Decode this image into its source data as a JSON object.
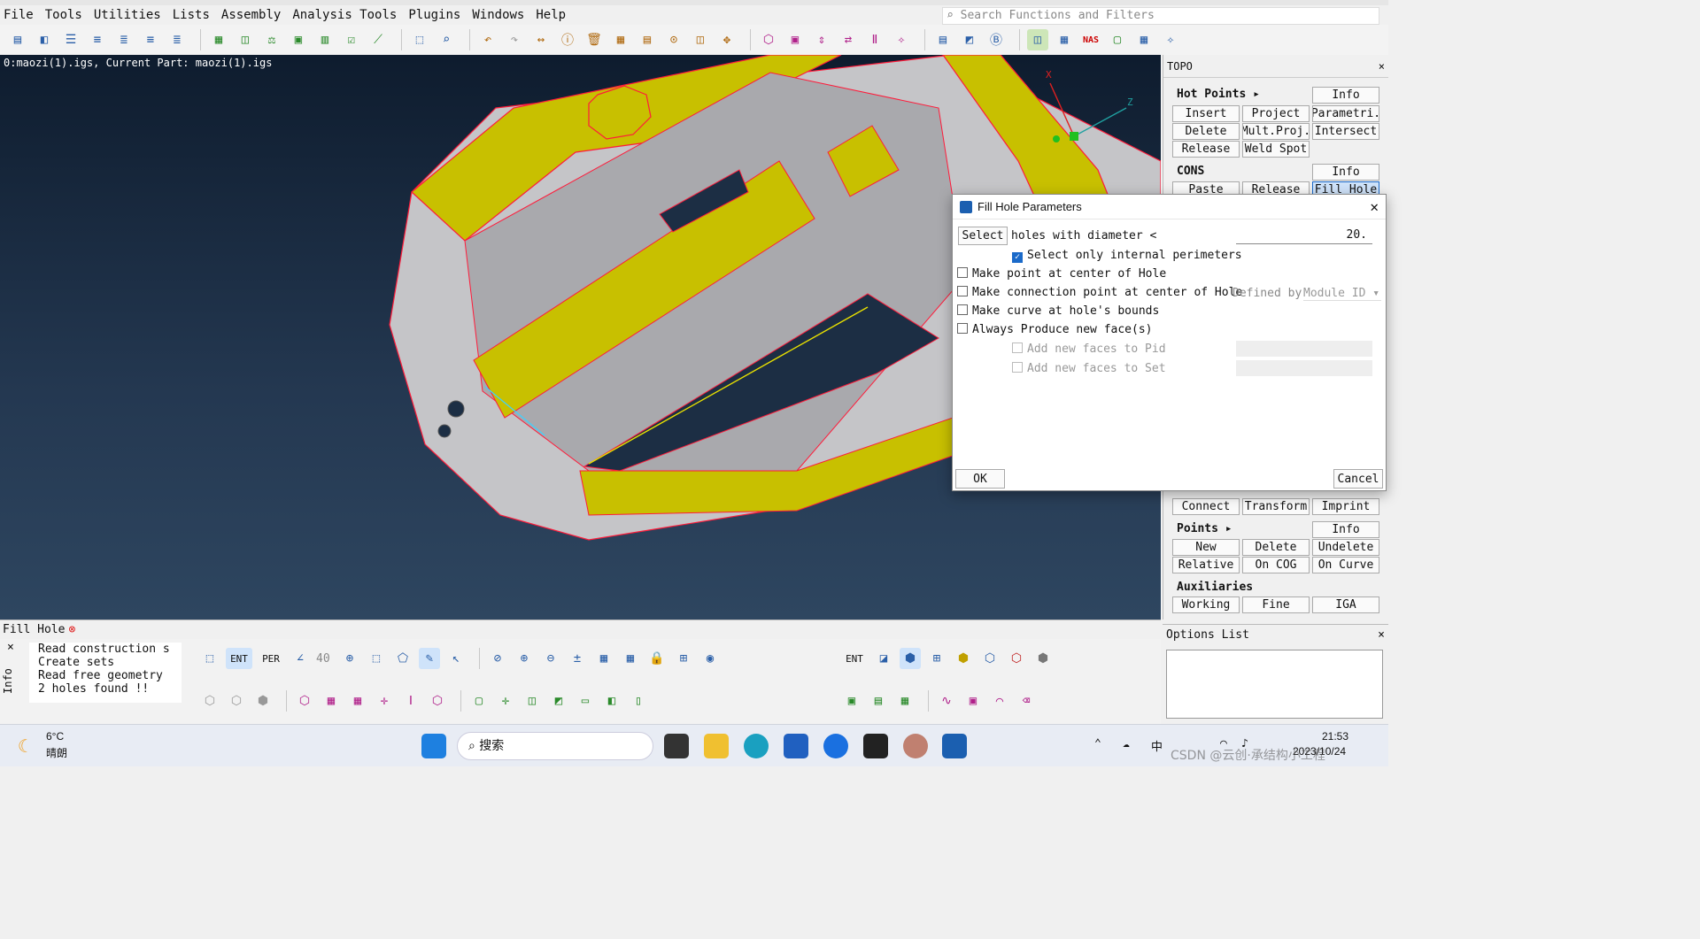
{
  "menu": [
    "File",
    "Tools",
    "Utilities",
    "Lists",
    "Assembly",
    "Analysis Tools",
    "Plugins",
    "Windows",
    "Help"
  ],
  "search_placeholder": "Search Functions and Filters",
  "viewport": {
    "label": "0:maozi(1).igs,  Current Part: maozi(1).igs"
  },
  "axes": {
    "x": "X",
    "z": "Z"
  },
  "panel": {
    "title": "TOPO",
    "hot_points": "Hot Points",
    "cons": "CONS",
    "points": "Points",
    "auxiliaries": "Auxiliaries",
    "buttons": {
      "info1": "Info",
      "insert": "Insert",
      "project": "Project",
      "parametri": "Parametri.",
      "delete1": "Delete",
      "multproj": "Mult.Proj.",
      "intersect": "Intersect",
      "release1": "Release",
      "weldspot": "Weld Spot",
      "info2": "Info",
      "paste": "Paste",
      "release2": "Release",
      "fillhole": "Fill Hole",
      "connect": "Connect",
      "transform": "Transform",
      "imprint": "Imprint",
      "info3": "Info",
      "new": "New",
      "delete2": "Delete",
      "undelete": "Undelete",
      "relative": "Relative",
      "oncog": "On COG",
      "oncurve": "On Curve",
      "working": "Working",
      "fine": "Fine",
      "iga": "IGA"
    }
  },
  "dialog": {
    "title": "Fill Hole Parameters",
    "select_btn": "Select",
    "holes_label": "holes with diameter <",
    "diameter": "20.",
    "opt_internal": "Select only internal perimeters",
    "opt_point": "Make point at center of Hole",
    "opt_conn": "Make connection point at center of Hole",
    "defined_by": "Defined by",
    "module_id": "Module ID",
    "opt_curve": "Make curve at hole's bounds",
    "opt_face": "Always Produce new face(s)",
    "opt_pid": "Add new faces to Pid",
    "opt_set": "Add new faces to Set",
    "ok": "OK",
    "cancel": "Cancel"
  },
  "status": {
    "label": "Fill Hole"
  },
  "console": {
    "lines": [
      "Read construction s",
      "Create sets",
      "Read free geometry",
      "2 holes found !!"
    ],
    "side_label": "Info"
  },
  "bottom_toolbar": {
    "ent": "ENT",
    "per": "PER",
    "angle": "40",
    "ent2": "ENT"
  },
  "options": {
    "title": "Options List"
  },
  "taskbar": {
    "weather_temp": "6°C",
    "weather_desc": "晴朗",
    "search": "搜索",
    "time": "21:53",
    "date": "2023/10/24",
    "ime": "中",
    "watermark": "CSDN @云创·承结构小工程"
  }
}
